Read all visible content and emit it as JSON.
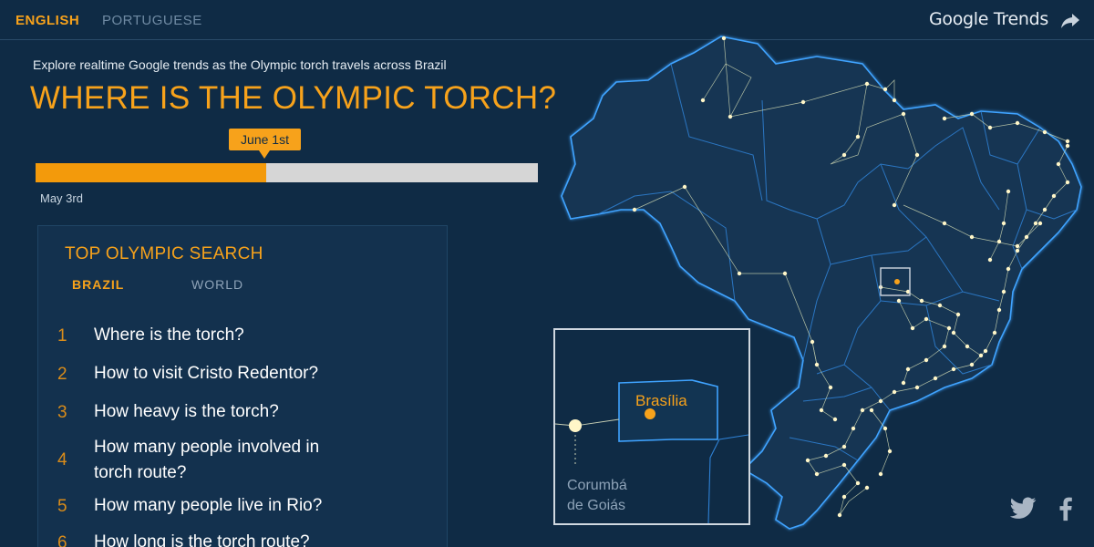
{
  "header": {
    "lang_en": "ENGLISH",
    "lang_pt": "PORTUGUESE",
    "brand": "Google Trends",
    "share_icon": "share-arrow-icon"
  },
  "intro": {
    "subtitle": "Explore realtime Google trends as the Olympic torch travels across Brazil",
    "title": "WHERE IS THE OLYMPIC TORCH?"
  },
  "timeline": {
    "current_date": "June 1st",
    "start_date": "May 3rd",
    "progress": 0.46
  },
  "searches": {
    "title": "TOP OLYMPIC SEARCH",
    "tabs": [
      "BRAZIL",
      "WORLD"
    ],
    "active_tab": "BRAZIL",
    "items": [
      {
        "rank": "1",
        "text": "Where is the torch?"
      },
      {
        "rank": "2",
        "text": "How to visit Cristo Redentor?"
      },
      {
        "rank": "3",
        "text": "How heavy is the torch?"
      },
      {
        "rank": "4",
        "text": "How many people involved in torch route?"
      },
      {
        "rank": "5",
        "text": "How many people live in Rio?"
      },
      {
        "rank": "6",
        "text": "How long is the torch route?"
      }
    ]
  },
  "inset": {
    "capital": "Brasília",
    "city_line1": "Corumbá",
    "city_line2": "de Goiás"
  },
  "social": {
    "twitter": "twitter-icon",
    "facebook": "facebook-icon"
  },
  "colors": {
    "background": "#0f2b45",
    "accent": "#f7a21b",
    "map_border": "#3fa3ff",
    "route_dot": "#fff6c8"
  }
}
